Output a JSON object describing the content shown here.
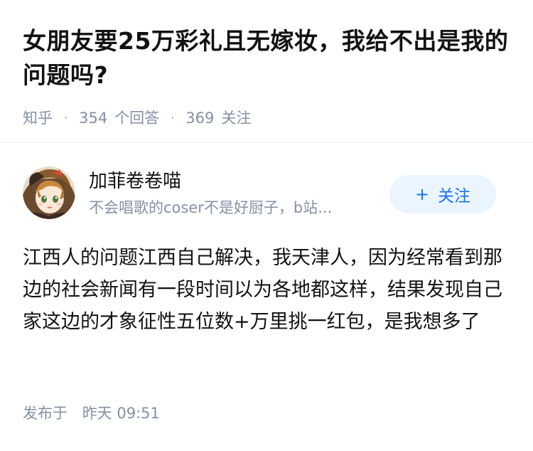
{
  "question": {
    "title": "女朋友要25万彩礼且无嫁妆，我给不出是我的问题吗?",
    "source": "知乎",
    "separator": "·",
    "answer_count": "354",
    "answer_label": "个回答",
    "follower_count": "369",
    "follower_label": "关注"
  },
  "author": {
    "name": "加菲卷卷喵",
    "bio": "不会唱歌的coser不是好厨子，b站...",
    "avatar_icon": "anime-girl-avatar-icon",
    "follow_plus": "+",
    "follow_label": "关注"
  },
  "answer": {
    "content": "江西人的问题江西自己解决，我天津人，因为经常看到那边的社会新闻有一段时间以为各地都这样，结果发现自己家这边的才象征性五位数+万里挑一红包，是我想多了",
    "published_label": "发布于",
    "published_time": "昨天 09:51"
  },
  "colors": {
    "text_primary": "#121212",
    "text_secondary": "#8590a6",
    "brand_blue": "#1772f6",
    "follow_bg": "#ebf5ff",
    "divider": "#f0f2f5"
  }
}
